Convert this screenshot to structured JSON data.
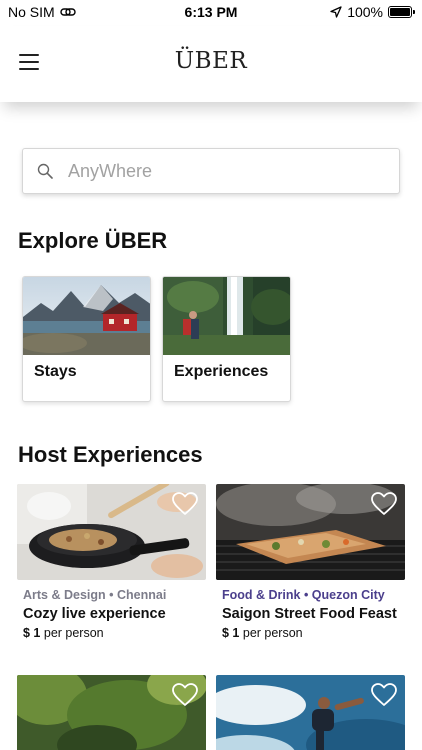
{
  "status_bar": {
    "carrier": "No SIM",
    "time": "6:13 PM",
    "battery": "100%"
  },
  "header": {
    "brand": "ÜBER"
  },
  "search": {
    "placeholder": "AnyWhere",
    "value": ""
  },
  "explore": {
    "heading": "Explore ÜBER",
    "cards": [
      {
        "label": "Stays"
      },
      {
        "label": "Experiences"
      }
    ]
  },
  "host": {
    "heading": "Host Experiences",
    "items": [
      {
        "category": "Arts & Design • Chennai",
        "category_color": "#7c7c8a",
        "title": "Cozy live experience",
        "price": "$ 1",
        "price_suffix": " per person"
      },
      {
        "category": "Food & Drink • Quezon City",
        "category_color": "#4b3f8c",
        "title": "Saigon Street Food Feast",
        "price": "$ 1",
        "price_suffix": " per person"
      }
    ]
  },
  "icons": [
    "wifi-link-icon",
    "location-arrow-icon",
    "battery-icon",
    "menu-icon",
    "search-icon",
    "heart-icon"
  ]
}
